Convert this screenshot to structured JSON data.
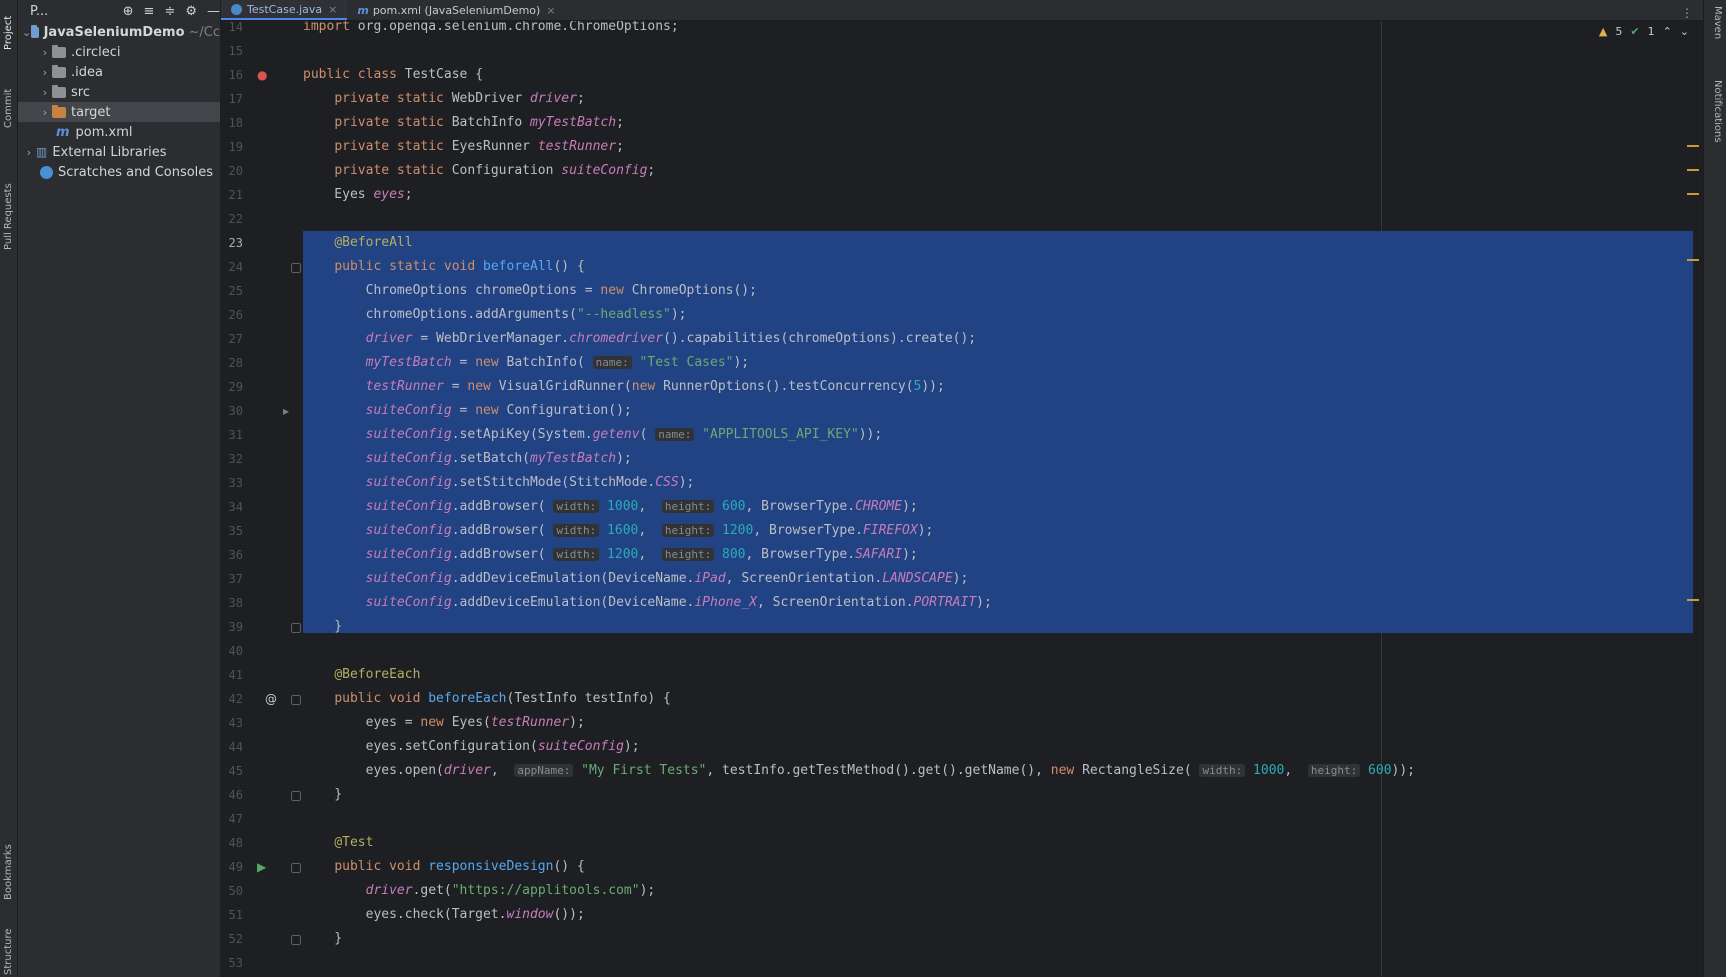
{
  "left_toolwindows": [
    "Project",
    "Commit",
    "Pull Requests",
    "Bookmarks",
    "Structure"
  ],
  "right_toolwindows": [
    "Maven",
    "Notifications"
  ],
  "project_panel": {
    "title": "P...",
    "tree": [
      {
        "label": "JavaSeleniumDemo",
        "suffix": "~/Cc",
        "icon": "module-folder-icon",
        "expanded": true
      },
      {
        "label": ".circleci",
        "icon": "folder-icon"
      },
      {
        "label": ".idea",
        "icon": "folder-icon"
      },
      {
        "label": "src",
        "icon": "folder-icon"
      },
      {
        "label": "target",
        "icon": "folder-orange-icon",
        "selected": true
      },
      {
        "label": "pom.xml",
        "icon": "maven-icon"
      },
      {
        "label": "External Libraries",
        "icon": "library-icon"
      },
      {
        "label": "Scratches and Consoles",
        "icon": "scratch-icon"
      }
    ]
  },
  "tabs": [
    {
      "label": "TestCase.java",
      "icon": "java-class-icon",
      "active": true
    },
    {
      "label": "pom.xml (JavaSeleniumDemo)",
      "icon": "maven-icon",
      "active": false
    }
  ],
  "inspection": {
    "warnings": "5",
    "checks": "1"
  },
  "editor": {
    "current_line": 23,
    "selection": [
      23,
      39
    ],
    "lines": [
      {
        "n": 14,
        "tokens": [
          [
            "k",
            "import "
          ],
          [
            "",
            "org.openqa.selenium.chrome.ChromeOptions;"
          ]
        ]
      },
      {
        "n": 15,
        "tokens": []
      },
      {
        "n": 16,
        "tokens": [
          [
            "k",
            "public class "
          ],
          [
            "",
            "TestCase {"
          ]
        ]
      },
      {
        "n": 17,
        "tokens": [
          [
            "",
            "    "
          ],
          [
            "k",
            "private static "
          ],
          [
            "",
            "WebDriver "
          ],
          [
            "f",
            "driver"
          ],
          [
            "",
            ";"
          ]
        ]
      },
      {
        "n": 18,
        "tokens": [
          [
            "",
            "    "
          ],
          [
            "k",
            "private static "
          ],
          [
            "",
            "BatchInfo "
          ],
          [
            "f",
            "myTestBatch"
          ],
          [
            "",
            ";"
          ]
        ]
      },
      {
        "n": 19,
        "tokens": [
          [
            "",
            "    "
          ],
          [
            "k",
            "private static "
          ],
          [
            "",
            "EyesRunner "
          ],
          [
            "f",
            "testRunner"
          ],
          [
            "",
            ";"
          ]
        ]
      },
      {
        "n": 20,
        "tokens": [
          [
            "",
            "    "
          ],
          [
            "k",
            "private static "
          ],
          [
            "",
            "Configuration "
          ],
          [
            "f",
            "suiteConfig"
          ],
          [
            "",
            ";"
          ]
        ]
      },
      {
        "n": 21,
        "tokens": [
          [
            "",
            "    Eyes "
          ],
          [
            "f",
            "eyes"
          ],
          [
            "",
            ";"
          ]
        ]
      },
      {
        "n": 22,
        "tokens": []
      },
      {
        "n": 23,
        "tokens": [
          [
            "",
            "    "
          ],
          [
            "a",
            "@BeforeAll"
          ]
        ]
      },
      {
        "n": 24,
        "tokens": [
          [
            "",
            "    "
          ],
          [
            "k",
            "public static void "
          ],
          [
            "m",
            "beforeAll"
          ],
          [
            "",
            "() {"
          ]
        ]
      },
      {
        "n": 25,
        "tokens": [
          [
            "",
            "        ChromeOptions chromeOptions = "
          ],
          [
            "k",
            "new "
          ],
          [
            "",
            "ChromeOptions();"
          ]
        ]
      },
      {
        "n": 26,
        "tokens": [
          [
            "",
            "        chromeOptions.addArguments("
          ],
          [
            "s",
            "\"--headless\""
          ],
          [
            "",
            ");"
          ]
        ]
      },
      {
        "n": 27,
        "tokens": [
          [
            "",
            "        "
          ],
          [
            "f",
            "driver"
          ],
          [
            "",
            " = WebDriverManager."
          ],
          [
            "f",
            "chromedriver"
          ],
          [
            "",
            "().capabilities(chromeOptions).create();"
          ]
        ]
      },
      {
        "n": 28,
        "tokens": [
          [
            "",
            "        "
          ],
          [
            "f",
            "myTestBatch"
          ],
          [
            "",
            " = "
          ],
          [
            "k",
            "new "
          ],
          [
            "",
            "BatchInfo( "
          ],
          [
            "h",
            "name:"
          ],
          [
            "s",
            " \"Test Cases\""
          ],
          [
            "",
            ");"
          ]
        ]
      },
      {
        "n": 29,
        "tokens": [
          [
            "",
            "        "
          ],
          [
            "f",
            "testRunner"
          ],
          [
            "",
            " = "
          ],
          [
            "k",
            "new "
          ],
          [
            "",
            "VisualGridRunner("
          ],
          [
            "k",
            "new "
          ],
          [
            "",
            "RunnerOptions().testConcurrency("
          ],
          [
            "n",
            "5"
          ],
          [
            "",
            "));"
          ]
        ]
      },
      {
        "n": 30,
        "tokens": [
          [
            "",
            "        "
          ],
          [
            "f",
            "suiteConfig"
          ],
          [
            "",
            " = "
          ],
          [
            "k",
            "new "
          ],
          [
            "",
            "Configuration();"
          ]
        ]
      },
      {
        "n": 31,
        "tokens": [
          [
            "",
            "        "
          ],
          [
            "f",
            "suiteConfig"
          ],
          [
            "",
            ".setApiKey(System."
          ],
          [
            "f",
            "getenv"
          ],
          [
            "",
            "( "
          ],
          [
            "h",
            "name:"
          ],
          [
            "s",
            " \"APPLITOOLS_API_KEY\""
          ],
          [
            "",
            "));"
          ]
        ]
      },
      {
        "n": 32,
        "tokens": [
          [
            "",
            "        "
          ],
          [
            "f",
            "suiteConfig"
          ],
          [
            "",
            ".setBatch("
          ],
          [
            "f",
            "myTestBatch"
          ],
          [
            "",
            ");"
          ]
        ]
      },
      {
        "n": 33,
        "tokens": [
          [
            "",
            "        "
          ],
          [
            "f",
            "suiteConfig"
          ],
          [
            "",
            ".setStitchMode(StitchMode."
          ],
          [
            "f",
            "CSS"
          ],
          [
            "",
            ");"
          ]
        ]
      },
      {
        "n": 34,
        "tokens": [
          [
            "",
            "        "
          ],
          [
            "f",
            "suiteConfig"
          ],
          [
            "",
            ".addBrowser( "
          ],
          [
            "h",
            "width:"
          ],
          [
            "n",
            " 1000"
          ],
          [
            "",
            ",  "
          ],
          [
            "h",
            "height:"
          ],
          [
            "n",
            " 600"
          ],
          [
            "",
            ", BrowserType."
          ],
          [
            "f",
            "CHROME"
          ],
          [
            "",
            ");"
          ]
        ]
      },
      {
        "n": 35,
        "tokens": [
          [
            "",
            "        "
          ],
          [
            "f",
            "suiteConfig"
          ],
          [
            "",
            ".addBrowser( "
          ],
          [
            "h",
            "width:"
          ],
          [
            "n",
            " 1600"
          ],
          [
            "",
            ",  "
          ],
          [
            "h",
            "height:"
          ],
          [
            "n",
            " 1200"
          ],
          [
            "",
            ", BrowserType."
          ],
          [
            "f",
            "FIREFOX"
          ],
          [
            "",
            ");"
          ]
        ]
      },
      {
        "n": 36,
        "tokens": [
          [
            "",
            "        "
          ],
          [
            "f",
            "suiteConfig"
          ],
          [
            "",
            ".addBrowser( "
          ],
          [
            "h",
            "width:"
          ],
          [
            "n",
            " 1200"
          ],
          [
            "",
            ",  "
          ],
          [
            "h",
            "height:"
          ],
          [
            "n",
            " 800"
          ],
          [
            "",
            ", BrowserType."
          ],
          [
            "f",
            "SAFARI"
          ],
          [
            "",
            ");"
          ]
        ]
      },
      {
        "n": 37,
        "tokens": [
          [
            "",
            "        "
          ],
          [
            "f",
            "suiteConfig"
          ],
          [
            "",
            ".addDeviceEmulation(DeviceName."
          ],
          [
            "f",
            "iPad"
          ],
          [
            "",
            ", ScreenOrientation."
          ],
          [
            "f",
            "LANDSCAPE"
          ],
          [
            "",
            ");"
          ]
        ]
      },
      {
        "n": 38,
        "tokens": [
          [
            "",
            "        "
          ],
          [
            "f",
            "suiteConfig"
          ],
          [
            "",
            ".addDeviceEmulation(DeviceName."
          ],
          [
            "f",
            "iPhone_X"
          ],
          [
            "",
            ", ScreenOrientation."
          ],
          [
            "f",
            "PORTRAIT"
          ],
          [
            "",
            ");"
          ]
        ]
      },
      {
        "n": 39,
        "tokens": [
          [
            "",
            "    }"
          ]
        ]
      },
      {
        "n": 40,
        "tokens": []
      },
      {
        "n": 41,
        "tokens": [
          [
            "",
            "    "
          ],
          [
            "a",
            "@BeforeEach"
          ]
        ]
      },
      {
        "n": 42,
        "tokens": [
          [
            "",
            "    "
          ],
          [
            "k",
            "public void "
          ],
          [
            "m",
            "beforeEach"
          ],
          [
            "",
            "(TestInfo testInfo) {"
          ]
        ]
      },
      {
        "n": 43,
        "tokens": [
          [
            "",
            "        eyes = "
          ],
          [
            "k",
            "new "
          ],
          [
            "",
            "Eyes("
          ],
          [
            "f",
            "testRunner"
          ],
          [
            "",
            ");"
          ]
        ]
      },
      {
        "n": 44,
        "tokens": [
          [
            "",
            "        eyes.setConfiguration("
          ],
          [
            "f",
            "suiteConfig"
          ],
          [
            "",
            ");"
          ]
        ]
      },
      {
        "n": 45,
        "tokens": [
          [
            "",
            "        eyes.open("
          ],
          [
            "f",
            "driver"
          ],
          [
            "",
            ",  "
          ],
          [
            "h",
            "appName:"
          ],
          [
            "s",
            " \"My First Tests\""
          ],
          [
            "",
            ", testInfo.getTestMethod().get().getName(), "
          ],
          [
            "k",
            "new "
          ],
          [
            "",
            "RectangleSize( "
          ],
          [
            "h",
            "width:"
          ],
          [
            "n",
            " 1000"
          ],
          [
            "",
            ",  "
          ],
          [
            "h",
            "height:"
          ],
          [
            "n",
            " 600"
          ],
          [
            "",
            "));"
          ]
        ]
      },
      {
        "n": 46,
        "tokens": [
          [
            "",
            "    }"
          ]
        ]
      },
      {
        "n": 47,
        "tokens": []
      },
      {
        "n": 48,
        "tokens": [
          [
            "",
            "    "
          ],
          [
            "a",
            "@Test"
          ]
        ]
      },
      {
        "n": 49,
        "tokens": [
          [
            "",
            "    "
          ],
          [
            "k",
            "public void "
          ],
          [
            "m",
            "responsiveDesign"
          ],
          [
            "",
            "() {"
          ]
        ]
      },
      {
        "n": 50,
        "tokens": [
          [
            "",
            "        "
          ],
          [
            "f",
            "driver"
          ],
          [
            "",
            ".get("
          ],
          [
            "s",
            "\"https://applitools.com\""
          ],
          [
            "",
            ");"
          ]
        ]
      },
      {
        "n": 51,
        "tokens": [
          [
            "",
            "        eyes.check(Target."
          ],
          [
            "f",
            "window"
          ],
          [
            "",
            "());"
          ]
        ]
      },
      {
        "n": 52,
        "tokens": [
          [
            "",
            "    }"
          ]
        ]
      },
      {
        "n": 53,
        "tokens": []
      }
    ]
  }
}
